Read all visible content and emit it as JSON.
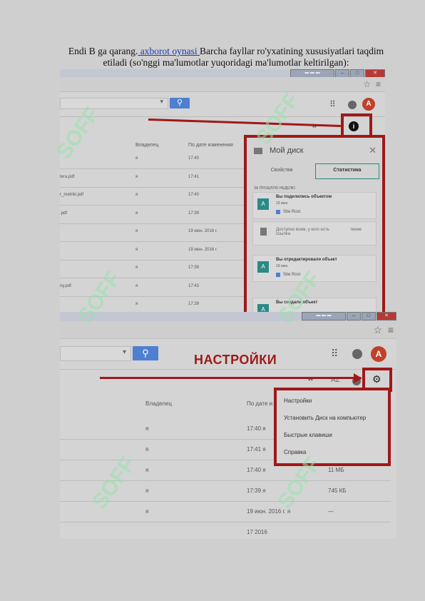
{
  "caption": {
    "part1": "Endi B ga qarang.",
    "link": " axborot oynasi ",
    "part2": "Barcha fayllar ro'yxatining xususiyatlari taqdim etiladi (so'nggi ma'lumotlar yuqoridagi ma'lumotlar keltirilgan):"
  },
  "shot1": {
    "columns": {
      "owner": "Владелец",
      "date": "По дате изменения"
    },
    "rows": [
      {
        "name": "",
        "owner": "я",
        "date": "17:40"
      },
      {
        "name": "tera.pdf",
        "owner": "я",
        "date": "17:41"
      },
      {
        "name": "r_metriki.pdf",
        "owner": "я",
        "date": "17:40"
      },
      {
        "name": ".pdf",
        "owner": "я",
        "date": "17:39"
      },
      {
        "name": "",
        "owner": "я",
        "date": "19 июн. 2016 г."
      },
      {
        "name": "",
        "owner": "я",
        "date": "19 июн. 2016 г."
      },
      {
        "name": "",
        "owner": "я",
        "date": "17:39"
      },
      {
        "name": "ny.pdf",
        "owner": "я",
        "date": "17:43"
      },
      {
        "name": "",
        "owner": "я",
        "date": "17:39"
      }
    ],
    "panel": {
      "title": "Мой диск",
      "tab_properties": "Свойства",
      "tab_stats": "Статистика",
      "section": "ЗА ПРОШЛУЮ НЕДЕЛЮ",
      "activities": [
        {
          "badge": "A",
          "title": "Вы поделились объектом",
          "date": "19 июн.",
          "file": "Site Rost"
        },
        {
          "badge": "A",
          "title": "Вы отредактировали объект",
          "date": "19 июн.",
          "file": "Site Rost"
        },
        {
          "badge": "A",
          "title": "Вы создали объект",
          "date": "",
          "file": ""
        }
      ],
      "share_note": "Доступно всем, у кого есть ссылка",
      "share_note_extra": "тение"
    },
    "avatar": "A",
    "view_toggle": "▪▪"
  },
  "shot2": {
    "heading": "НАСТРОЙКИ",
    "avatar": "A",
    "sort_label": "AZ",
    "columns": {
      "owner": "Владелец",
      "date": "По дате и"
    },
    "rows": [
      {
        "owner": "я",
        "date": "17:40  я",
        "size": ""
      },
      {
        "owner": "я",
        "date": "17:41  я",
        "size": ""
      },
      {
        "owner": "я",
        "date": "17:40  я",
        "size": "11 МБ"
      },
      {
        "owner": "я",
        "date": "17:39  я",
        "size": "745 КБ"
      },
      {
        "owner": "я",
        "date": "19 июн. 2016 г.  я",
        "size": "—"
      },
      {
        "owner": "",
        "date": "17   2016",
        "size": ""
      }
    ],
    "menu": [
      "Настройки",
      "Установить Диск на компьютер",
      "Быстрые клавиши",
      "Справка"
    ]
  },
  "watermark": "SOFF",
  "colors": {
    "accent_red": "#a01818",
    "link_blue": "#1a3bb0",
    "search_blue": "#4f7fd0",
    "avatar": "#c0402a",
    "teal": "#2b8a88"
  }
}
